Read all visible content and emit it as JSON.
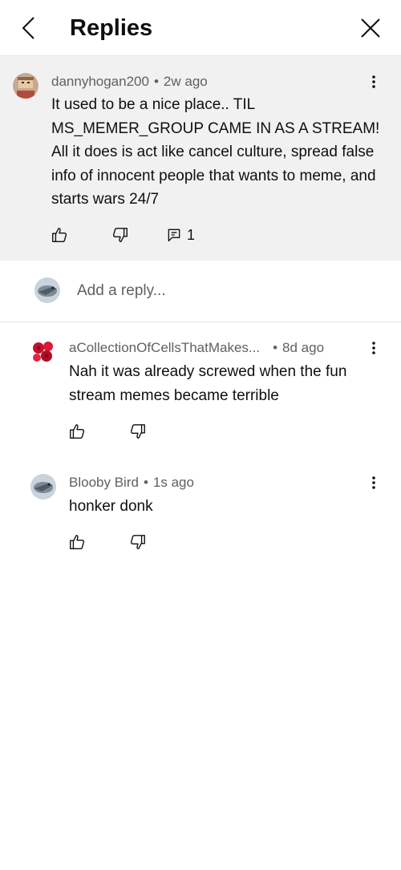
{
  "header": {
    "title": "Replies",
    "back_icon": "chevron-left-icon",
    "close_icon": "close-icon"
  },
  "parent_comment": {
    "author": "dannyhogan200",
    "separator": "•",
    "time": "2w ago",
    "text": "It used to be a nice place.. TIL MS_MEMER_GROUP CAME IN AS A STREAM! All it does is act like cancel culture, spread false info of innocent people that wants to meme, and starts wars 24/7",
    "reply_count": "1"
  },
  "add_reply": {
    "placeholder": "Add a reply..."
  },
  "replies": [
    {
      "author": "aCollectionOfCellsThatMakes...",
      "separator": "•",
      "time": "8d ago",
      "text": "Nah it was already screwed when the fun stream memes became terrible"
    },
    {
      "author": "Blooby Bird",
      "separator": "•",
      "time": "1s ago",
      "text": "honker donk"
    }
  ],
  "colors": {
    "parent_bg": "#f1f1f1",
    "meta_text": "#606060",
    "divider": "#e5e5e5"
  }
}
